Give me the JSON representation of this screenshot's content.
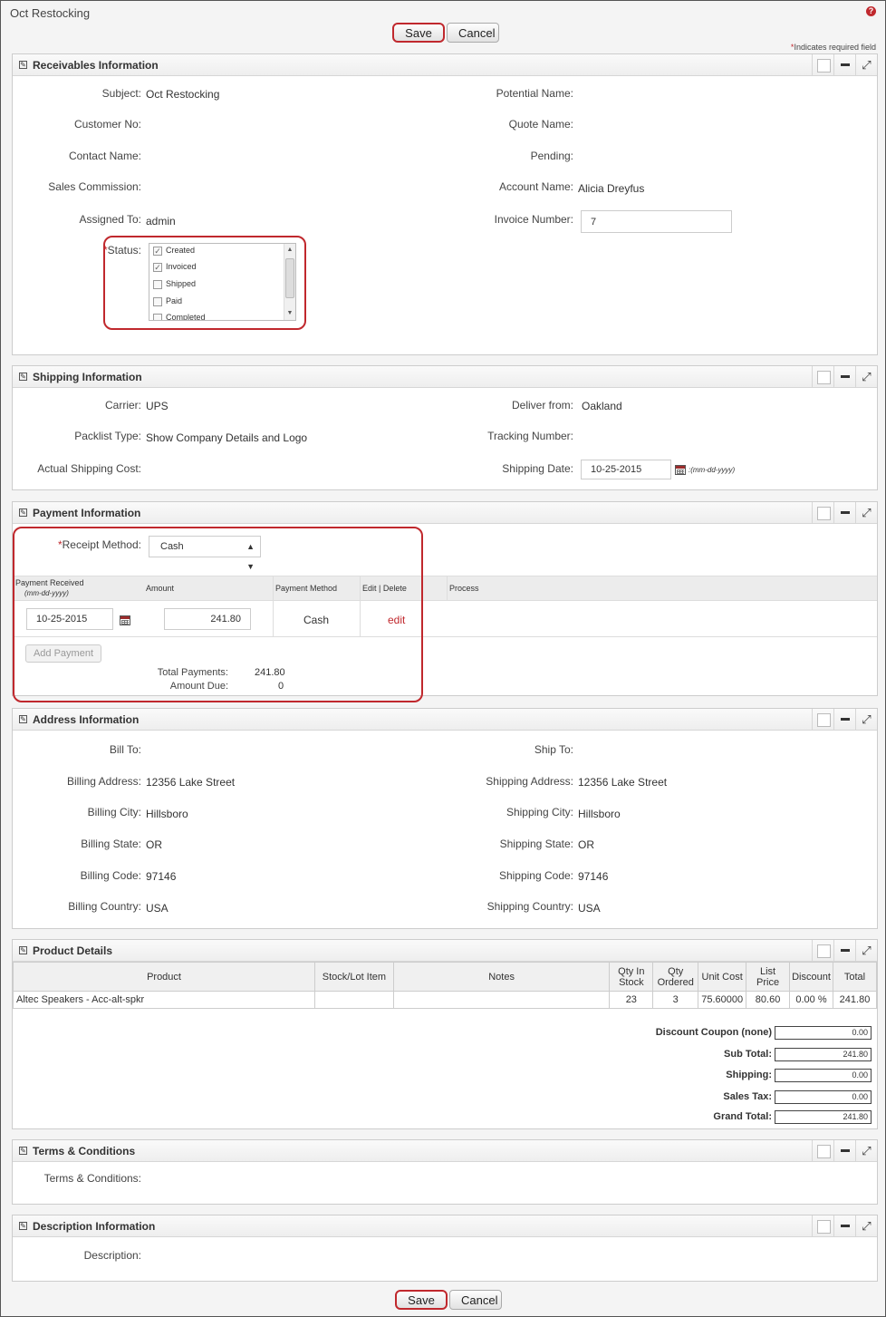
{
  "page": {
    "title": "Oct Restocking",
    "required_note": "Indicates required field",
    "required_mark": "*"
  },
  "buttons": {
    "save": "Save",
    "cancel": "Cancel"
  },
  "receivables": {
    "title": "Receivables Information",
    "subject_label": "Subject:",
    "subject": "Oct Restocking",
    "customer_no_label": "Customer No:",
    "contact_name_label": "Contact Name:",
    "sales_commission_label": "Sales Commission:",
    "assigned_to_label": "Assigned To:",
    "assigned_to": "admin",
    "status_label": "Status:",
    "status_options": [
      {
        "label": "Created",
        "checked": "✓"
      },
      {
        "label": "Invoiced",
        "checked": "✓"
      },
      {
        "label": "Shipped",
        "checked": ""
      },
      {
        "label": "Paid",
        "checked": ""
      },
      {
        "label": "Completed",
        "checked": ""
      }
    ],
    "potential_name_label": "Potential Name:",
    "quote_name_label": "Quote Name:",
    "pending_label": "Pending:",
    "account_name_label": "Account Name:",
    "account_name": "Alicia Dreyfus",
    "invoice_number_label": "Invoice Number:",
    "invoice_number": "7"
  },
  "shipping": {
    "title": "Shipping Information",
    "carrier_label": "Carrier:",
    "carrier": "UPS",
    "packlist_label": "Packlist Type:",
    "packlist": "Show Company Details and Logo",
    "actual_cost_label": "Actual Shipping Cost:",
    "deliver_from_label": "Deliver from:",
    "deliver_from": "Oakland",
    "tracking_label": "Tracking Number:",
    "shipping_date_label": "Shipping Date:",
    "shipping_date": "10-25-2015",
    "date_format": ":(mm-dd-yyyy)"
  },
  "payment": {
    "title": "Payment Information",
    "receipt_method_label": "Receipt Method:",
    "receipt_method": "Cash",
    "col_received": "Payment Received",
    "col_received_fmt": "(mm-dd-yyyy)",
    "col_amount": "Amount",
    "col_method": "Payment Method",
    "col_edit": "Edit | Delete",
    "col_process": "Process",
    "row_date": "10-25-2015",
    "row_amount": "241.80",
    "row_method": "Cash",
    "row_edit": "edit",
    "add_payment": "Add Payment",
    "total_payments_label": "Total Payments:",
    "total_payments": "241.80",
    "amount_due_label": "Amount Due:",
    "amount_due": "0"
  },
  "address": {
    "title": "Address Information",
    "bill_to_label": "Bill To:",
    "ship_to_label": "Ship To:",
    "billing_address_label": "Billing Address:",
    "billing_address": "12356 Lake Street",
    "billing_city_label": "Billing City:",
    "billing_city": "Hillsboro",
    "billing_state_label": "Billing State:",
    "billing_state": "OR",
    "billing_code_label": "Billing Code:",
    "billing_code": "97146",
    "billing_country_label": "Billing Country:",
    "billing_country": "USA",
    "shipping_address_label": "Shipping Address:",
    "shipping_address": "12356 Lake Street",
    "shipping_city_label": "Shipping City:",
    "shipping_city": "Hillsboro",
    "shipping_state_label": "Shipping State:",
    "shipping_state": "OR",
    "shipping_code_label": "Shipping Code:",
    "shipping_code": "97146",
    "shipping_country_label": "Shipping Country:",
    "shipping_country": "USA"
  },
  "products": {
    "title": "Product Details",
    "headers": [
      "Product",
      "Stock/Lot Item",
      "Notes",
      "Qty In Stock",
      "Qty Ordered",
      "Unit Cost",
      "List Price",
      "Discount",
      "Total"
    ],
    "rows": [
      [
        "Altec Speakers - Acc-alt-spkr",
        "",
        "",
        "23",
        "3",
        "75.60000",
        "80.60",
        "0.00 %",
        "241.80"
      ]
    ],
    "totals": [
      {
        "label": "Discount Coupon (none)",
        "value": "0.00"
      },
      {
        "label": "Sub Total:",
        "value": "241.80"
      },
      {
        "label": "Shipping:",
        "value": "0.00"
      },
      {
        "label": "Sales Tax:",
        "value": "0.00"
      },
      {
        "label": "Grand Total:",
        "value": "241.80"
      }
    ]
  },
  "terms": {
    "title": "Terms & Conditions",
    "label": "Terms & Conditions:"
  },
  "description": {
    "title": "Description Information",
    "label": "Description:"
  },
  "icons": {
    "edit": "edit-square-icon",
    "minimize": "minus-icon",
    "expand": "expand-arrows-icon",
    "calendar": "calendar-icon",
    "help": "help-icon"
  },
  "colors": {
    "accent_red": "#c0282d",
    "header_gray": "#eeeeee"
  }
}
